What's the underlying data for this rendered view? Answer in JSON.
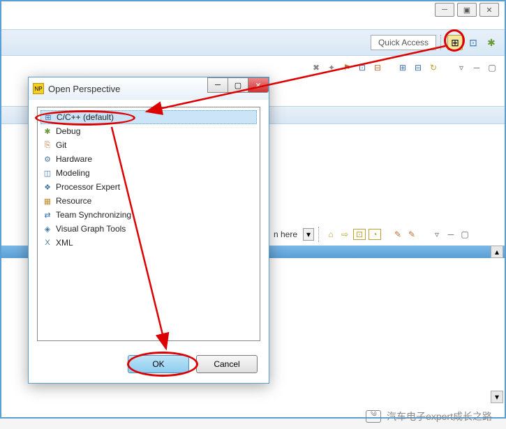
{
  "window": {
    "minimize": "─",
    "maximize": "▣",
    "close": "✕"
  },
  "topbar": {
    "quick_access": "Quick Access"
  },
  "lower": {
    "hint": "n here",
    "dropdown": "▾"
  },
  "dialog": {
    "title": "Open Perspective",
    "icon_text": "NP",
    "items": [
      {
        "icon": "⊞",
        "label": "C/C++ (default)",
        "color": "#3a70b0"
      },
      {
        "icon": "✱",
        "label": "Debug",
        "color": "#6a9a3a"
      },
      {
        "icon": "⎘",
        "label": "Git",
        "color": "#c07030"
      },
      {
        "icon": "⚙",
        "label": "Hardware",
        "color": "#4a7aa0"
      },
      {
        "icon": "◫",
        "label": "Modeling",
        "color": "#3a70b0"
      },
      {
        "icon": "❖",
        "label": "Processor Expert",
        "color": "#4a7aa0"
      },
      {
        "icon": "▦",
        "label": "Resource",
        "color": "#c09030"
      },
      {
        "icon": "⇄",
        "label": "Team Synchronizing",
        "color": "#3a70b0"
      },
      {
        "icon": "◈",
        "label": "Visual Graph Tools",
        "color": "#4a7aa0"
      },
      {
        "icon": "X",
        "label": "XML",
        "color": "#4a7aa0"
      }
    ],
    "ok": "OK",
    "cancel": "Cancel"
  },
  "watermark": {
    "text": "汽车电子expert成长之路"
  }
}
